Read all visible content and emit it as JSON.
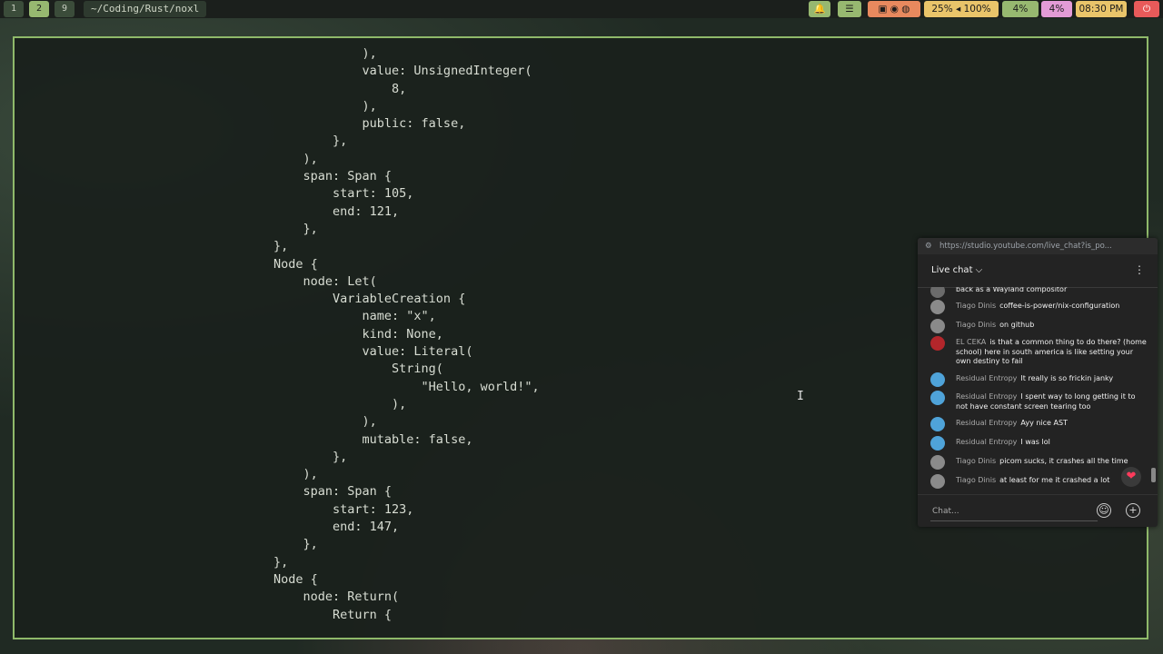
{
  "topbar": {
    "workspaces": [
      "1",
      "2",
      "9"
    ],
    "path": "~/Coding/Rust/noxl",
    "audio": "25% ◂ 100%",
    "cpu": "4%",
    "mem": "4%",
    "clock": "08:30 PM"
  },
  "terminal": {
    "lines": [
      "            ),",
      "            value: UnsignedInteger(",
      "                8,",
      "            ),",
      "            public: false,",
      "        },",
      "    ),",
      "    span: Span {",
      "        start: 105,",
      "        end: 121,",
      "    },",
      "},",
      "Node {",
      "    node: Let(",
      "        VariableCreation {",
      "            name: \"x\",",
      "            kind: None,",
      "            value: Literal(",
      "                String(",
      "                    \"Hello, world!\",",
      "                ),",
      "            ),",
      "            mutable: false,",
      "        },",
      "    ),",
      "    span: Span {",
      "        start: 123,",
      "        end: 147,",
      "    },",
      "},",
      "Node {",
      "    node: Return(",
      "        Return {"
    ]
  },
  "chat": {
    "url": "https://studio.youtube.com/live_chat?is_po...",
    "title": "Live chat ⌵",
    "messages": [
      {
        "author": "",
        "text": "back as a Wayland compositor",
        "avatar_color": "#6b6b6b"
      },
      {
        "author": "Tiago Dinis",
        "text": "coffee-is-power/nix-configuration",
        "avatar_color": "#8a8a8a"
      },
      {
        "author": "Tiago Dinis",
        "text": "on github",
        "avatar_color": "#8a8a8a"
      },
      {
        "author": "EL CEKA",
        "text": "is that a common thing to do there? (home school) here in south america is like setting your own destiny to fail",
        "avatar_color": "#b3262b"
      },
      {
        "author": "Residual Entropy",
        "text": "It really is so frickin janky",
        "avatar_color": "#4fa3d9"
      },
      {
        "author": "Residual Entropy",
        "text": "I spent way to long getting it to not have constant screen tearing too",
        "avatar_color": "#4fa3d9"
      },
      {
        "author": "Residual Entropy",
        "text": "Ayy nice AST",
        "avatar_color": "#4fa3d9"
      },
      {
        "author": "Residual Entropy",
        "text": "I was lol",
        "avatar_color": "#4fa3d9"
      },
      {
        "author": "Tiago Dinis",
        "text": "picom sucks, it crashes all the time",
        "avatar_color": "#8a8a8a"
      },
      {
        "author": "Tiago Dinis",
        "text": "at least for me it crashed a lot",
        "avatar_color": "#8a8a8a"
      }
    ],
    "input_placeholder": "Chat...",
    "heart": "❤"
  }
}
